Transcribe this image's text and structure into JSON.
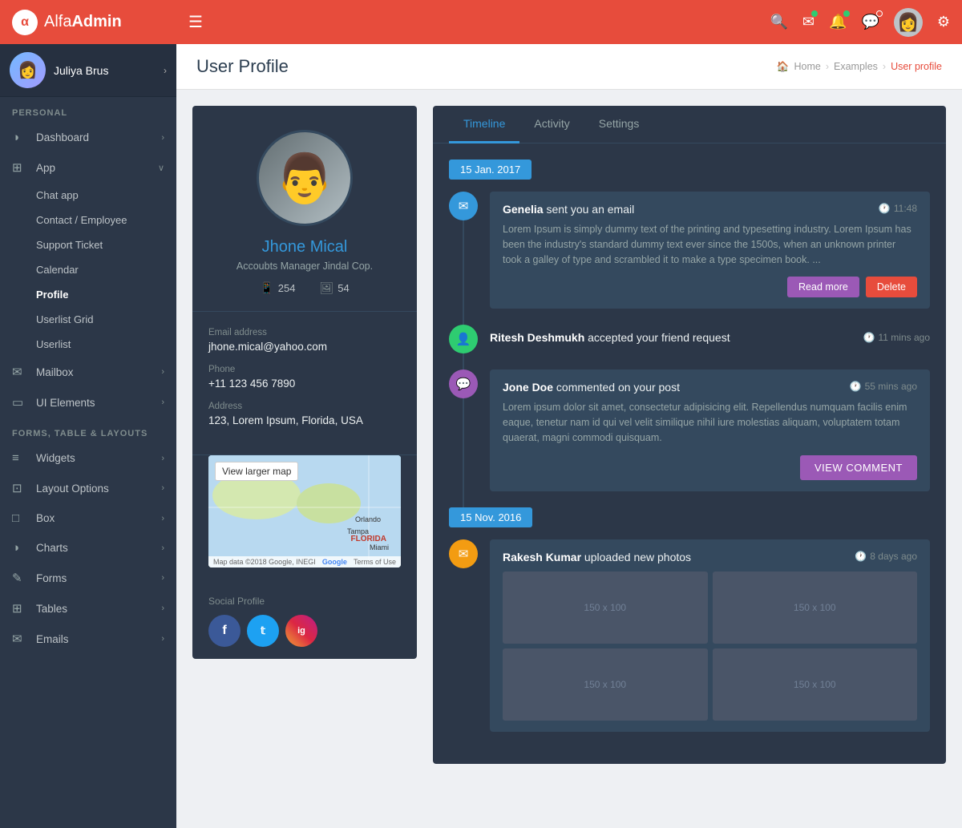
{
  "brand": {
    "logo_text": "α",
    "name_part1": "Alfa",
    "name_part2": "Admin"
  },
  "navbar": {
    "hamburger": "☰",
    "icons": {
      "search": "🔍",
      "mail": "✉",
      "bell": "🔔",
      "chat": "💬"
    }
  },
  "sidebar": {
    "user_name": "Juliya Brus",
    "sections": [
      {
        "label": "PERSONAL",
        "items": [
          {
            "id": "dashboard",
            "icon": "◑",
            "label": "Dashboard",
            "has_arrow": true,
            "active": false
          },
          {
            "id": "app",
            "icon": "⊞",
            "label": "App",
            "has_arrow": true,
            "active": false,
            "expanded": true,
            "children": [
              {
                "id": "chat-app",
                "label": "Chat app",
                "active": false
              },
              {
                "id": "contact-employee",
                "label": "Contact / Employee",
                "active": false
              },
              {
                "id": "support-ticket",
                "label": "Support Ticket",
                "active": false
              },
              {
                "id": "calendar",
                "label": "Calendar",
                "active": false
              },
              {
                "id": "profile",
                "label": "Profile",
                "active": true
              },
              {
                "id": "userlist-grid",
                "label": "Userlist Grid",
                "active": false
              },
              {
                "id": "userlist",
                "label": "Userlist",
                "active": false
              }
            ]
          },
          {
            "id": "mailbox",
            "icon": "✉",
            "label": "Mailbox",
            "has_arrow": true,
            "active": false
          },
          {
            "id": "ui-elements",
            "icon": "▭",
            "label": "UI Elements",
            "has_arrow": true,
            "active": false
          }
        ]
      },
      {
        "label": "FORMS, TABLE & LAYOUTS",
        "items": [
          {
            "id": "widgets",
            "icon": "≡",
            "label": "Widgets",
            "has_arrow": true,
            "active": false
          },
          {
            "id": "layout-options",
            "icon": "⊡",
            "label": "Layout Options",
            "has_arrow": true,
            "active": false
          },
          {
            "id": "box",
            "icon": "□",
            "label": "Box",
            "has_arrow": true,
            "active": false
          },
          {
            "id": "charts",
            "icon": "◑",
            "label": "Charts",
            "has_arrow": true,
            "active": false
          },
          {
            "id": "forms",
            "icon": "✎",
            "label": "Forms",
            "has_arrow": true,
            "active": false
          },
          {
            "id": "tables",
            "icon": "⊞",
            "label": "Tables",
            "has_arrow": true,
            "active": false
          },
          {
            "id": "emails",
            "icon": "✉",
            "label": "Emails",
            "has_arrow": true,
            "active": false
          }
        ]
      }
    ]
  },
  "page": {
    "title": "User Profile",
    "breadcrumb": {
      "home": "Home",
      "section": "Examples",
      "current": "User profile"
    }
  },
  "profile": {
    "name": "Jhone Mical",
    "title": "Accoubts Manager Jindal Cop.",
    "followers": "254",
    "following": "54",
    "email_label": "Email address",
    "email": "jhone.mical@yahoo.com",
    "phone_label": "Phone",
    "phone": "+11 123 456 7890",
    "address_label": "Address",
    "address": "123, Lorem Ipsum, Florida, USA",
    "map_btn": "View larger map",
    "map_data_label": "Map data ©2018 Google, INEGI",
    "map_terms": "Terms of Use",
    "google_logo": "Google",
    "social_label": "Social Profile",
    "social": [
      {
        "id": "facebook",
        "letter": "f",
        "color": "#3b5998"
      },
      {
        "id": "twitter",
        "letter": "t",
        "color": "#1da1f2"
      },
      {
        "id": "instagram",
        "letter": "ig",
        "color": "#e1306c"
      }
    ]
  },
  "timeline": {
    "tabs": [
      "Timeline",
      "Activity",
      "Settings"
    ],
    "active_tab": 0,
    "date_badge_1": "15 Jan. 2017",
    "date_badge_2": "15 Nov. 2016",
    "items": [
      {
        "dot_color": "dot-blue",
        "dot_icon": "✉",
        "type": "card",
        "title_strong": "Genelia",
        "title_rest": " sent you an email",
        "time": "11:48",
        "body": "Lorem Ipsum is simply dummy text of the printing and typesetting industry. Lorem Ipsum has been the industry's standard dummy text ever since the 1500s, when an unknown printer took a galley of type and scrambled it to make a type specimen book. ...",
        "actions": [
          {
            "id": "read-more",
            "label": "Read more",
            "class": "btn-read-more"
          },
          {
            "id": "delete",
            "label": "Delete",
            "class": "btn-delete"
          }
        ]
      },
      {
        "dot_color": "dot-green",
        "dot_icon": "👤",
        "type": "simple",
        "title_strong": "Ritesh Deshmukh",
        "title_rest": " accepted your friend request",
        "time": "11 mins ago"
      },
      {
        "dot_color": "dot-purple",
        "dot_icon": "💬",
        "type": "card",
        "title_strong": "Jone Doe",
        "title_rest": " commented on your post",
        "time": "55 mins ago",
        "body": "Lorem ipsum dolor sit amet, consectetur adipisicing elit. Repellendus numquam facilis enim eaque, tenetur nam id qui vel velit similique nihil iure molestias aliquam, voluptatem totam quaerat, magni commodi quisquam.",
        "actions": [
          {
            "id": "view-comment",
            "label": "VIEW COMMENT",
            "class": "btn-view-comment"
          }
        ]
      }
    ],
    "items2": [
      {
        "dot_color": "dot-yellow",
        "dot_icon": "✉",
        "type": "photo",
        "title_strong": "Rakesh Kumar",
        "title_rest": " uploaded new photos",
        "time": "8 days ago",
        "photos": [
          "150 x 100",
          "150 x 100",
          "150 x 100",
          "150 x 100"
        ]
      }
    ]
  }
}
